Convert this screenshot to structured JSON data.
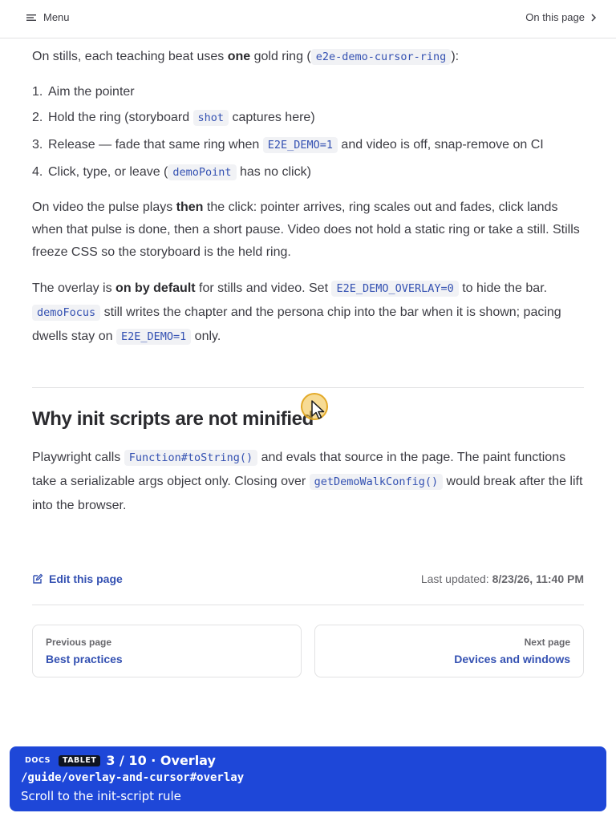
{
  "topbar": {
    "menu_label": "Menu",
    "on_this_page_label": "On this page"
  },
  "intro": {
    "text_1": "On stills, each teaching beat uses ",
    "strong_1": "one",
    "text_2": " gold ring (",
    "code_1": "e2e-demo-cursor-ring",
    "text_3": "):"
  },
  "steps": [
    {
      "num": "1.",
      "text_1": "Aim the pointer"
    },
    {
      "num": "2.",
      "text_1": "Hold the ring (storyboard ",
      "code": "shot",
      "text_2": " captures here)"
    },
    {
      "num": "3.",
      "text_1": "Release — fade that same ring when ",
      "code": "E2E_DEMO=1",
      "text_2": " and video is off, snap-remove on CI"
    },
    {
      "num": "4.",
      "text_1": "Click, type, or leave (",
      "code": "demoPoint",
      "text_2": " has no click)"
    }
  ],
  "video_para": {
    "text_1": "On video the pulse plays ",
    "strong_1": "then",
    "text_2": " the click: pointer arrives, ring scales out and fades, click lands when that pulse is done, then a short pause. Video does not hold a static ring or take a still. Stills freeze CSS so the storyboard is the held ring."
  },
  "overlay_para": {
    "text_1": "The overlay is ",
    "strong_1": "on by default",
    "text_2": " for stills and video. Set ",
    "code_1": "E2E_DEMO_OVERLAY=0",
    "text_3": " to hide the bar. ",
    "code_2": "demoFocus",
    "text_4": " still writes the chapter and the persona chip into the bar when it is shown; pacing dwells stay on ",
    "code_3": "E2E_DEMO=1",
    "text_5": " only."
  },
  "section": {
    "heading": "Why init scripts are not minified",
    "text_1": "Playwright calls ",
    "code_1": "Function#toString()",
    "text_2": " and evals that source in the page. The paint functions take a serializable args object only. Closing over ",
    "code_2": "getDemoWalkConfig()",
    "text_3": " would break after the lift into the browser."
  },
  "footer": {
    "edit_label": "Edit this page",
    "last_updated_label": "Last updated:",
    "last_updated_value": "8/23/26, 11:40 PM"
  },
  "pager": {
    "prev_desc": "Previous page",
    "prev_title": "Best practices",
    "next_desc": "Next page",
    "next_title": "Devices and windows"
  },
  "overlay": {
    "chip_docs": "DOCS",
    "chip_device": "TABLET",
    "chapter": "3 / 10 · Overlay",
    "route": "/guide/overlay-and-cursor#overlay",
    "action": "Scroll to the init-script rule"
  },
  "colors": {
    "brand": "#3451b2",
    "overlay_bg": "#1e47d8",
    "cursor_ring": "#f0be3c"
  }
}
